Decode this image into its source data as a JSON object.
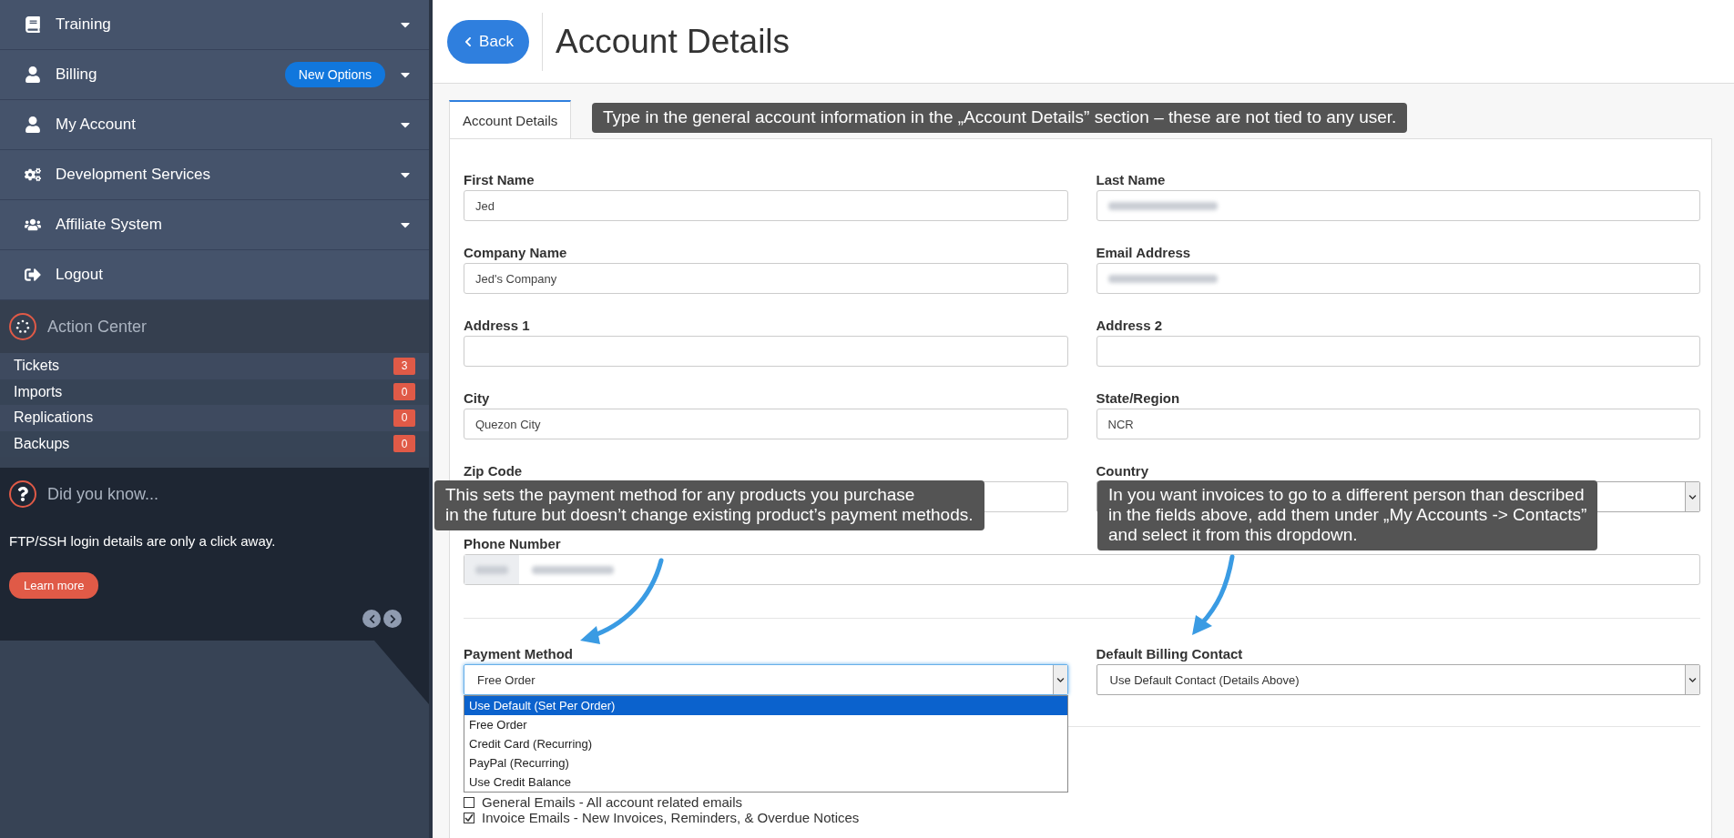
{
  "sidebar": {
    "menu": [
      {
        "label": "Training",
        "expandable": true
      },
      {
        "label": "Billing",
        "expandable": true,
        "badge": "New Options"
      },
      {
        "label": "My Account",
        "expandable": true
      },
      {
        "label": "Development Services",
        "expandable": true
      },
      {
        "label": "Affiliate System",
        "expandable": true
      },
      {
        "label": "Logout",
        "expandable": false
      }
    ],
    "action_center": {
      "title": "Action Center",
      "items": [
        {
          "label": "Tickets",
          "count": "3"
        },
        {
          "label": "Imports",
          "count": "0"
        },
        {
          "label": "Replications",
          "count": "0"
        },
        {
          "label": "Backups",
          "count": "0"
        }
      ]
    },
    "tip": {
      "title": "Did you know...",
      "text": "FTP/SSH login details are only a click away.",
      "button": "Learn more"
    }
  },
  "header": {
    "back": "Back",
    "title": "Account Details"
  },
  "tabs": [
    {
      "label": "Account Details",
      "selected": true
    }
  ],
  "form": {
    "fields": [
      {
        "label": "First Name",
        "kind": "text",
        "value": "Jed",
        "redacted": false
      },
      {
        "label": "Last Name",
        "kind": "text",
        "redacted": true
      },
      {
        "label": "Company Name",
        "kind": "text",
        "value": "Jed's Company",
        "redacted": false
      },
      {
        "label": "Email Address",
        "kind": "text",
        "redacted": true
      },
      {
        "label": "Address 1",
        "kind": "text",
        "redacted": false
      },
      {
        "label": "Address 2",
        "kind": "text",
        "redacted": false
      },
      {
        "label": "City",
        "kind": "text",
        "value": "Quezon City",
        "redacted": false
      },
      {
        "label": "State/Region",
        "kind": "text",
        "value": "NCR",
        "redacted": false
      },
      {
        "label": "Zip Code",
        "kind": "text"
      },
      {
        "label": "Country",
        "kind": "select"
      },
      {
        "label": "Phone Number",
        "kind": "phone",
        "redacted": true
      }
    ],
    "payment_method": {
      "label": "Payment Method",
      "value": "Free Order",
      "expanded": true,
      "options": [
        {
          "label": "Use Default (Set Per Order)",
          "highlighted": true
        },
        {
          "label": "Free Order",
          "highlighted": false
        },
        {
          "label": "Credit Card (Recurring)",
          "highlighted": false
        },
        {
          "label": "PayPal (Recurring)",
          "highlighted": false
        },
        {
          "label": "Use Credit Balance",
          "highlighted": false
        }
      ]
    },
    "billing_contact": {
      "label": "Default Billing Contact",
      "value": "Use Default Contact (Details Above)"
    },
    "email_preferences": [
      {
        "label": "General Emails - All account related emails",
        "checked": false
      },
      {
        "label": "Invoice Emails - New Invoices, Reminders, & Overdue Notices",
        "checked": true
      }
    ]
  },
  "callouts": [
    {
      "lines": [
        "Type in the general account information in the „Account Details” section – these are not tied to any user."
      ]
    },
    {
      "lines": [
        "This sets the payment method for any products you purchase",
        "in the future but doesn’t change existing product’s payment methods."
      ]
    },
    {
      "lines": [
        "In you want invoices to go to a different person than described",
        "in the fields above, add them under „My Accounts -> Contacts”",
        "and select it from this dropdown."
      ]
    }
  ]
}
